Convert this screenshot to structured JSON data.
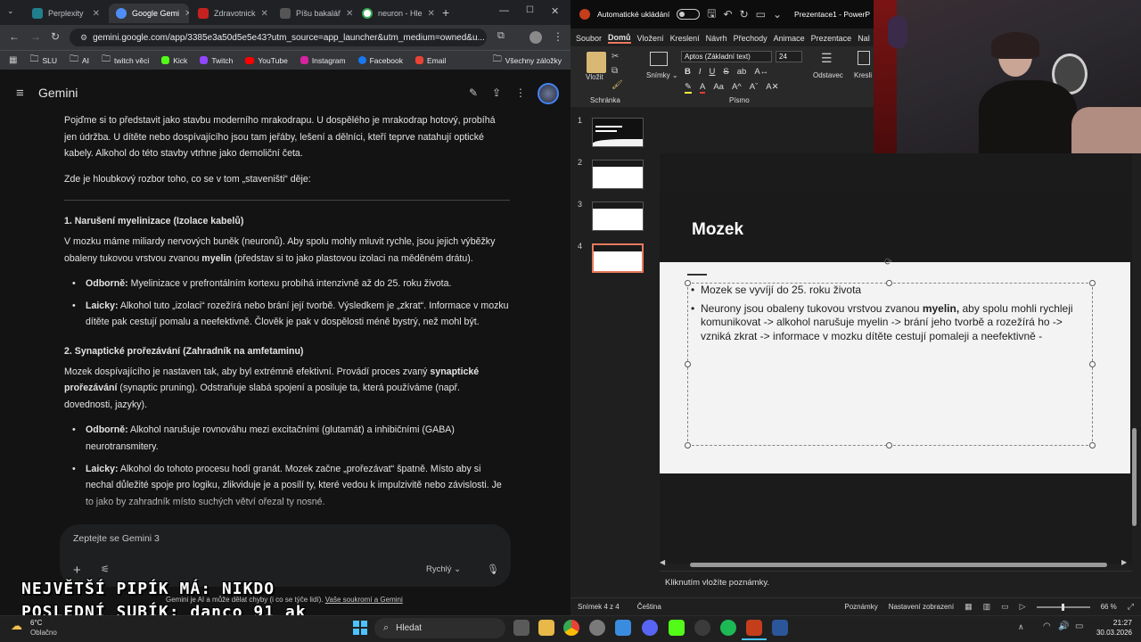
{
  "chrome": {
    "tabs": [
      {
        "label": "Perplexity",
        "color": "#20808d"
      },
      {
        "label": "Google Gemi",
        "color": "#4f8ef7"
      },
      {
        "label": "Zdravotnick",
        "color": "#c5221f"
      },
      {
        "label": "Píšu bakalář",
        "color": "#2b2b2b"
      },
      {
        "label": "neuron - Hle",
        "color": "#34a853"
      }
    ],
    "url": "gemini.google.com/app/3385e3a50d5e5e43?utm_source=app_launcher&utm_medium=owned&u...",
    "bookmarks": [
      "SLU",
      "AI",
      "twitch věci",
      "Kick",
      "Twitch",
      "YouTube",
      "Instagram",
      "Facebook",
      "Email"
    ],
    "bookmarks_all": "Všechny záložky"
  },
  "gemini": {
    "title": "Gemini",
    "intro": "Pojďme si to představit jako stavbu moderního mrakodrapu. U dospělého je mrakodrap hotový, probíhá jen údržba. U dítěte nebo dospívajícího jsou tam jeřáby, lešení a dělníci, kteří teprve natahují optické kabely. Alkohol do této stavby vtrhne jako demoliční četa.",
    "lead": "Zde je hloubkový rozbor toho, co se v tom „staveništi“ děje:",
    "s1_title": "1. Narušení myelinizace (Izolace kabelů)",
    "s1_p_a": "V mozku máme miliardy nervových buněk (neuronů). Aby spolu mohly mluvit rychle, jsou jejich výběžky obaleny tukovou vrstvou zvanou ",
    "s1_p_b": "myelin",
    "s1_p_c": " (představ si to jako plastovou izolaci na měděném drátu).",
    "s1_b1_k": "Odborně:",
    "s1_b1": " Myelinizace v prefrontálním kortexu probíhá intenzivně až do 25. roku života.",
    "s1_b2_k": "Laicky:",
    "s1_b2": " Alkohol tuto „izolaci“ rozežírá nebo brání její tvorbě. Výsledkem je „zkrat“. Informace v mozku dítěte pak cestují pomalu a neefektivně. Člověk je pak v dospělosti méně bystrý, než mohl být.",
    "s2_title": "2. Synaptické prořezávání (Zahradník na amfetaminu)",
    "s2_p_a": "Mozek dospívajícího je nastaven tak, aby byl extrémně efektivní. Provádí proces zvaný ",
    "s2_p_b": "synaptické prořezávání",
    "s2_p_c": " (synaptic pruning). Odstraňuje slabá spojení a posiluje ta, která používáme (např. dovednosti, jazyky).",
    "s2_b1_k": "Odborně:",
    "s2_b1": " Alkohol narušuje rovnováhu mezi excitačními (glutamát) a inhibičními (GABA) neurotransmitery.",
    "s2_b2_k": "Laicky:",
    "s2_b2": " Alkohol do tohoto procesu hodí granát. Mozek začne „prořezávat“ špatně. Místo aby si nechal důležité spoje pro logiku, zlikviduje je a posílí ty, které vedou k impulzivitě nebo závislosti. Je to jako by zahradník místo suchých větví ořezal ty nosné.",
    "input_placeholder": "Zeptejte se Gemini 3",
    "mode": "Rychlý",
    "disclaimer_a": "Gemini je AI a může dělat chyby (i co se týče lidí). ",
    "disclaimer_b": "Vaše soukromí a Gemini"
  },
  "overlay": {
    "line1": "NEJVĚTŠÍ PIPÍK MÁ: NIKDO",
    "line2": "POSLEDNÍ SUBÍK: danco_91_ak"
  },
  "ppt": {
    "autosave": "Automatické ukládání",
    "doc_title": "Prezentace1 - PowerP",
    "menu": [
      "Soubor",
      "Domů",
      "Vložení",
      "Kreslení",
      "Návrh",
      "Přechody",
      "Animace",
      "Prezentace",
      "Nal"
    ],
    "paste": "Vložit",
    "clipboard": "Schránka",
    "slides_btn": "Snímky",
    "font_name": "Aptos (Základní text)",
    "font_size": "24",
    "font_group": "Písmo",
    "paragraph": "Odstavec",
    "draw": "Kresli",
    "slide_title": "Mozek",
    "bullets": [
      "Mozek se vyvíjí do 25. roku života",
      "Neurony jsou obaleny tukovou vrstvou zvanou myelin, aby spolu mohli rychleji komunikovat -> alkohol narušuje myelin -> brání jeho tvorbě a rozežírá ho -> vzniká zkrat -> informace v mozku dítěte cestují pomaleji a neefektivně -"
    ],
    "bullet2_a": "Neurony jsou obaleny tukovou vrstvou zvanou ",
    "bullet2_b": "myelin,",
    "bullet2_c": " aby spolu mohli rychleji komunikovat -> alkohol narušuje myelin -> brání jeho tvorbě a rozežírá ho -> vzniká zkrat -> informace v mozku dítěte cestují pomaleji a neefektivně -",
    "thumb_nums": [
      "1",
      "2",
      "3",
      "4"
    ],
    "notes": "Kliknutím vložíte poznámky.",
    "status_slide": "Snímek 4 z 4",
    "status_lang": "Čeština",
    "status_notes": "Poznámky",
    "status_view": "Nastavení zobrazení",
    "zoom": "66 %"
  },
  "taskbar": {
    "weather_temp": "6°C",
    "weather_desc": "Oblačno",
    "search": "Hledat",
    "time": "21:27",
    "date": "30.03.2026"
  }
}
